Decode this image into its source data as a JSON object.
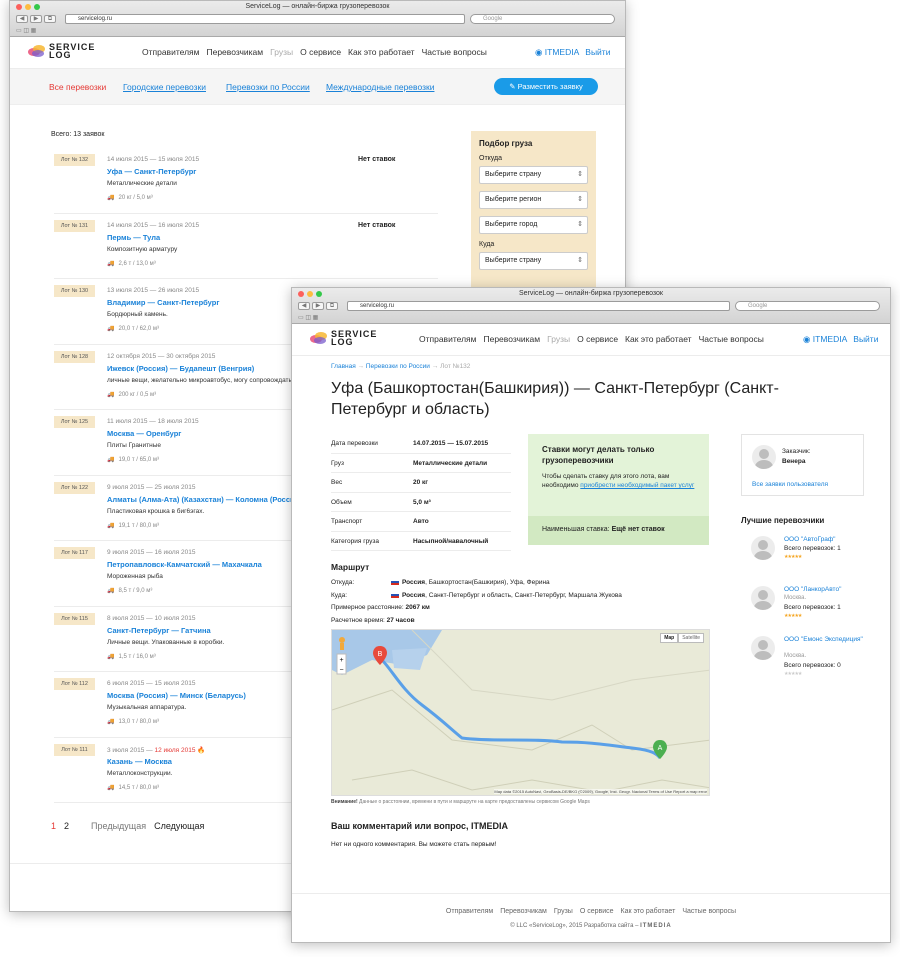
{
  "browser": {
    "title": "ServiceLog — онлайн-биржа грузоперевозок",
    "url": "servicelog.ru",
    "search_placeholder": "Google"
  },
  "logo": {
    "line1": "SERVICE",
    "line2": "LOG"
  },
  "menu": {
    "items": [
      "Отправителям",
      "Перевозчикам",
      "Грузы",
      "О сервисе",
      "Как это работает",
      "Частые вопросы"
    ],
    "user": "ITMEDIA",
    "logout": "Выйти"
  },
  "tabs": {
    "items": [
      "Все перевозки",
      "Городские перевозки",
      "Перевозки по России",
      "Международные перевозки"
    ],
    "post_button": "Разместить заявку"
  },
  "list": {
    "total": "Всего: 13 заявок",
    "lots": [
      {
        "lot": "Лот № 132",
        "dates": "14 июля 2015 — 15 июля 2015",
        "route": "Уфа — Санкт-Петербург",
        "cargo": "Металлические детали",
        "meta": "20 кг / 5,0 м³",
        "bids": "Нет ставок"
      },
      {
        "lot": "Лот № 131",
        "dates": "14 июля 2015 — 16 июля 2015",
        "route": "Пермь — Тула",
        "cargo": "Композитную арматуру",
        "meta": "2,6 т / 13,0 м³",
        "bids": "Нет ставок"
      },
      {
        "lot": "Лот № 130",
        "dates": "13 июля 2015 — 26 июля 2015",
        "route": "Владимир — Санкт-Петербург",
        "cargo": "Бордюрный камень.",
        "meta": "20,0 т / 62,0 м³",
        "bids": ""
      },
      {
        "lot": "Лот № 128",
        "dates": "12 октября 2015 — 30 октября 2015",
        "route": "Ижевск (Россия) — Будапешт (Венгрия)",
        "cargo": "личные вещи, желательно микроавтобус, могу сопровождать",
        "meta": "200 кг / 0,5 м³",
        "bids": ""
      },
      {
        "lot": "Лот № 125",
        "dates": "11 июля 2015 — 18 июля 2015",
        "route": "Москва — Оренбург",
        "cargo": "Плиты Гранитные",
        "meta": "19,0 т / 65,0 м³",
        "bids": ""
      },
      {
        "lot": "Лот № 122",
        "dates": "9 июля 2015 — 25 июля 2015",
        "route": "Алматы (Алма-Ата) (Казахстан) — Коломна (Россия)",
        "cargo": "Пластиковая крошка в биг6эгах.",
        "meta": "19,1 т / 80,0 м³",
        "bids": ""
      },
      {
        "lot": "Лот № 117",
        "dates": "9 июля 2015 — 16 июля 2015",
        "route": "Петропавловск-Камчатский — Махачкала",
        "cargo": "Мороженная рыба",
        "meta": "8,5 т / 9,0 м³",
        "bids": ""
      },
      {
        "lot": "Лот № 115",
        "dates": "8 июля 2015 — 10 июля 2015",
        "route": "Санкт-Петербург — Гатчина",
        "cargo": "Личные вещи. Упакованные в коробки.",
        "meta": "1,5 т / 16,0 м³",
        "bids": ""
      },
      {
        "lot": "Лот № 112",
        "dates": "6 июля 2015 — 15 июля 2015",
        "route": "Москва (Россия) — Минск (Беларусь)",
        "cargo": "Музыкальная аппаратура.",
        "meta": "13,0 т / 80,0 м³",
        "bids": ""
      },
      {
        "lot": "Лот № 111",
        "dates": "3 июля 2015 — ",
        "dates_hot": "12 июля 2015",
        "route": "Казань — Москва",
        "cargo": "Металлоконструкции.",
        "meta": "14,5 т / 80,0 м³",
        "bids": ""
      }
    ],
    "pages": [
      "1",
      "2"
    ],
    "prev": "Предыдущая",
    "next": "Следующая"
  },
  "filter": {
    "title": "Подбор груза",
    "from": "Откуда",
    "to": "Куда",
    "country": "Выберите страну",
    "region": "Выберите регион",
    "city": "Выберите город"
  },
  "footer1": {
    "links": "Отправителям   Перевозчикам   Гру",
    "copy": "© LLC «ServiceLog», 2"
  },
  "detail": {
    "crumbs": [
      "Главная",
      "Перевозки по России",
      "Лот №132"
    ],
    "title": "Уфа (Башкортостан(Башкирия)) — Санкт-Петербург (Санкт-Петербург и область)",
    "specs": [
      {
        "k": "Дата перевозки",
        "v": "14.07.2015 — 15.07.2015"
      },
      {
        "k": "Груз",
        "v": "Металлические детали"
      },
      {
        "k": "Вес",
        "v": "20 кг"
      },
      {
        "k": "Объем",
        "v": "5,0 м³"
      },
      {
        "k": "Транспорт",
        "v": "Авто"
      },
      {
        "k": "Категория груза",
        "v": "Насыпной/навалочный"
      }
    ],
    "bid_box": {
      "title": "Ставки могут делать только грузоперевозчики",
      "text": "Чтобы сделать ставку для этого лота, вам необходимо ",
      "link": "приобрести необходимый пакет услуг",
      "min_label": "Наименьшая ставка:",
      "min_value": "Ещё нет ставок"
    },
    "route_title": "Маршрут",
    "from_label": "Откуда:",
    "from_country": "Россия",
    "from_text": ", Башкортостан(Башкирия), Уфа, Ферина",
    "to_label": "Куда:",
    "to_country": "Россия",
    "to_text": ", Санкт-Петербург и область, Санкт-Петербург, Маршала Жукова",
    "dist_label": "Примерное расстояние:",
    "dist": "2067 км",
    "time_label": "Расчетное время:",
    "time": "27 часов",
    "map_note_bold": "Внимание!",
    "map_note": " Данные о расстоянии, времени в пути и маршруте на карте предоставлены сервисом Google Maps",
    "map_attr": "Map data ©2015 AutoNavi, GeoBasis-DE/BKG (©2009), Google, Inst. Geogr. Nacional   Terms of Use   Report a map error",
    "map_btns": [
      "Map",
      "Satellite"
    ],
    "comment_title": "Ваш комментарий или вопрос, ITMEDIA",
    "comment_empty": "Нет ни одного комментария. Вы можете стать первым!",
    "customer": {
      "label": "Заказчик:",
      "name": "Венера",
      "all": "Все заявки пользователя"
    },
    "best_title": "Лучшие перевозчики",
    "carriers": [
      {
        "name": "ООО \"АвтоГраф\"",
        "city": "",
        "total": "Всего перевозок: 1",
        "stars": "★★★★★"
      },
      {
        "name": "ООО \"ЛанкорАвто\"",
        "city": "Москва.",
        "total": "Всего перевозок: 1",
        "stars": "★★★★★"
      },
      {
        "name": "ООО \"Емонс Экспедиция\"",
        "city": "Москва.",
        "total": "Всего перевозок: 0",
        "stars": "★★★★★"
      }
    ]
  },
  "footer2": {
    "links": [
      "Отправителям",
      "Перевозчикам",
      "Грузы",
      "О сервисе",
      "Как это работает",
      "Частые вопросы"
    ],
    "copy": "© LLC «ServiceLog», 2015",
    "dev": "Разработка сайта –",
    "dev_name": "ITMEDIA"
  },
  "colors": {
    "accent": "#1a82d8",
    "red": "#e53935",
    "beige": "#f6e7c8",
    "green": "#e3f3d8"
  }
}
